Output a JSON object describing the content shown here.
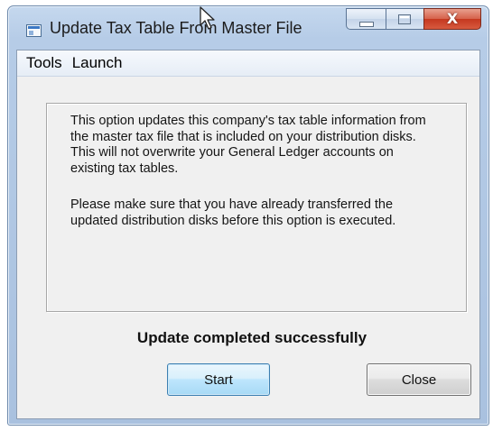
{
  "window": {
    "title": "Update Tax Table From Master File"
  },
  "menu": {
    "items": [
      {
        "label": "Tools"
      },
      {
        "label": "Launch"
      }
    ]
  },
  "info": {
    "paragraph1": "This option updates this company's tax table information from the master tax file that is included on your distribution disks. This will not overwrite your General Ledger accounts on existing tax tables.",
    "paragraph2": "Please make sure that you have already transferred the updated distribution disks before this option is executed."
  },
  "status": {
    "message": "Update completed successfully"
  },
  "buttons": {
    "start_label": "Start",
    "close_label": "Close"
  },
  "caption_buttons": {
    "close_glyph": "X"
  },
  "colors": {
    "close_button": "#c5381f",
    "default_button_border": "#3c7fb1",
    "title_bar": "#b6cce7"
  },
  "icons": [
    "app-icon",
    "minimize-icon",
    "maximize-icon",
    "close-icon",
    "mouse-cursor-icon"
  ]
}
